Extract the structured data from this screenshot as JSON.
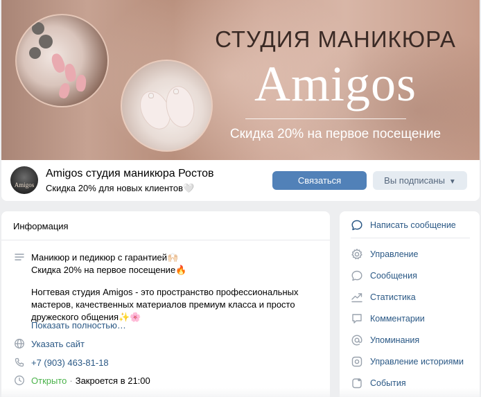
{
  "cover": {
    "title": "СТУДИЯ МАНИКЮРА",
    "brand": "Amigos",
    "promo": "Скидка 20% на первое посещение"
  },
  "header": {
    "avatar_text": "Amigos",
    "name": "Amigos студия маникюра Ростов",
    "status": "Скидка 20% для новых клиентов🤍",
    "contact_label": "Связаться",
    "subscribed_label": "Вы подписаны"
  },
  "info": {
    "title": "Информация",
    "description_line1": "Маникюр и педикюр с гарантией🙌🏻",
    "description_line2": "Скидка 20% на первое посещение🔥",
    "description_para2": "Ногтевая студия Amigos - это пространство профессиональных\nмастеров, качественных материалов премиум класса и просто\nдружеского общения✨🌸",
    "show_more": "Показать полностью…",
    "website": "Указать сайт",
    "phone": "+7 (903) 463-81-18",
    "open_status": "Открыто",
    "closes": "Закроется в 21:00"
  },
  "sidebar": {
    "items": [
      {
        "label": "Написать сообщение"
      },
      {
        "label": "Управление"
      },
      {
        "label": "Сообщения"
      },
      {
        "label": "Статистика"
      },
      {
        "label": "Комментарии"
      },
      {
        "label": "Упоминания"
      },
      {
        "label": "Управление историями"
      },
      {
        "label": "События"
      }
    ]
  },
  "colors": {
    "accent": "#5181b8",
    "link": "#2a5885",
    "open": "#4bb34b",
    "icon": "#99a2ad"
  }
}
